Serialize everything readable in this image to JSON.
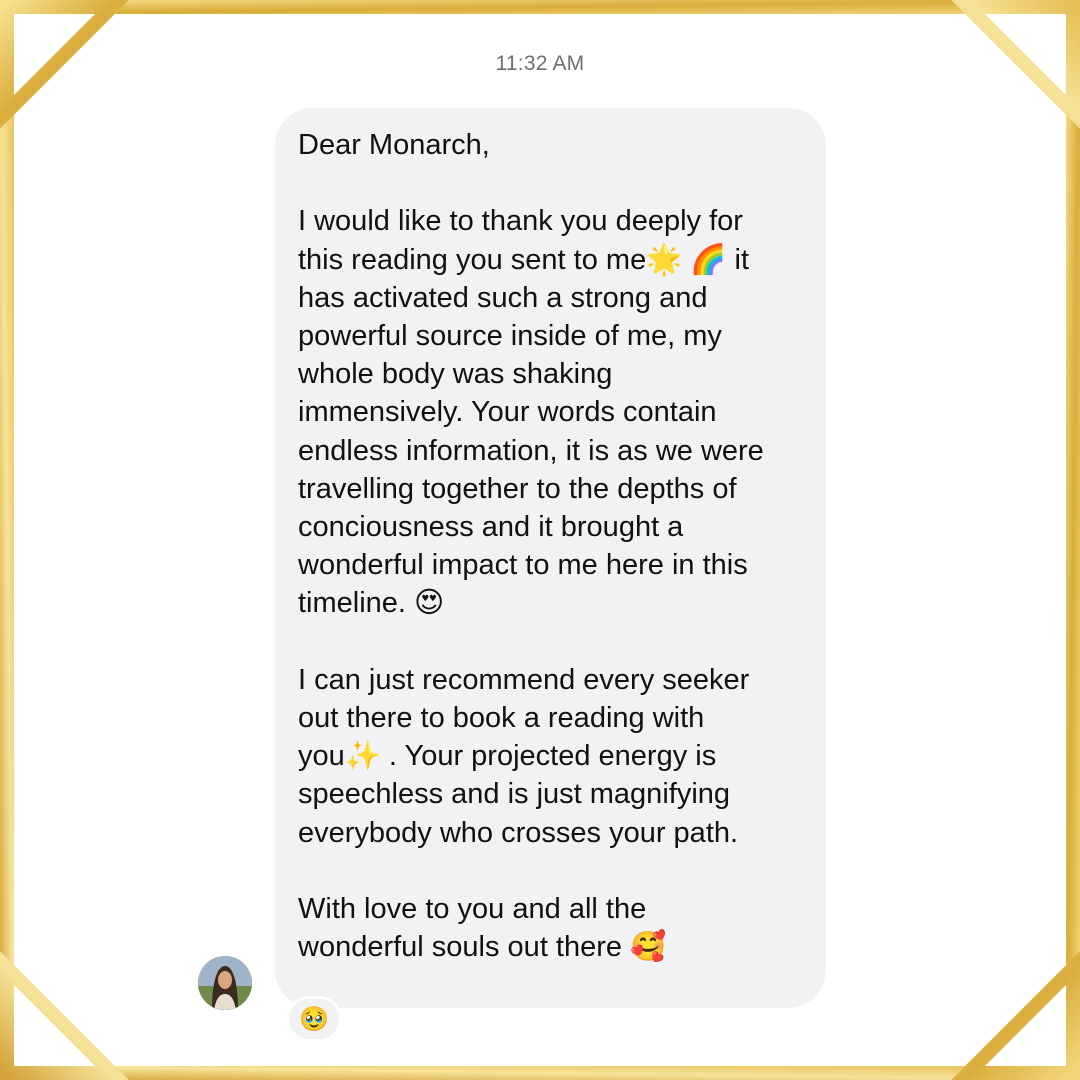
{
  "conversation": {
    "timestamp": "11:32 AM",
    "message": {
      "text": "Dear Monarch,\n\nI would like to thank you deeply for\nthis reading you sent to me🌟 🌈  it\nhas activated such a strong and\npowerful source inside of me, my\nwhole body was shaking\nimmensively. Your words contain\nendless information, it is as we were\ntravelling together to the depths of\nconciousness and it brought a\nwonderful impact to me here in this\ntimeline. 😍\n\nI can just recommend every seeker\nout there to book a reading with\nyou✨ . Your projected energy  is\nspeechless and is just magnifying\neverybody who crosses your path.\n\nWith love to you and all the\nwonderful souls out there 🥰"
    },
    "reaction": "🥹"
  },
  "colors": {
    "frame_gold": "#E2B94A",
    "bubble_bg": "#F2F2F4",
    "timestamp_gray": "#6E6E73"
  }
}
